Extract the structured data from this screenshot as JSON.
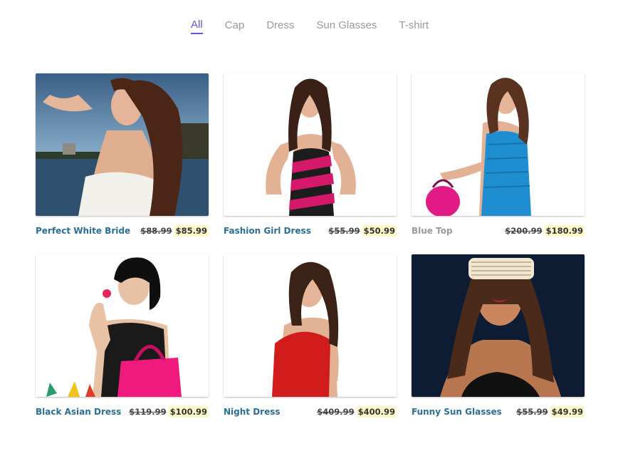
{
  "filters": {
    "tabs": [
      "All",
      "Cap",
      "Dress",
      "Sun Glasses",
      "T-shirt"
    ],
    "active": "All"
  },
  "products": [
    {
      "name": "Perfect White Bride",
      "old_price": "$88.99",
      "price": "$85.99",
      "image": "woman with curly hair, white strapless dress, lake background"
    },
    {
      "name": "Fashion Girl Dress",
      "old_price": "$55.99",
      "price": "$50.99",
      "image": "woman in black and pink striped dress"
    },
    {
      "name": "Blue Top",
      "old_price": "$200.99",
      "price": "$180.99",
      "image": "woman in blue top holding pink bag"
    },
    {
      "name": "Black Asian Dress",
      "old_price": "$119.99",
      "price": "$100.99",
      "image": "woman with pink handbag smelling a flower"
    },
    {
      "name": "Night Dress",
      "old_price": "$409.99",
      "price": "$400.99",
      "image": "woman in red dress pointing"
    },
    {
      "name": "Funny Sun Glasses",
      "old_price": "$55.99",
      "price": "$49.99",
      "image": "woman with shutter shades on dark background"
    }
  ],
  "colors": {
    "accent": "#5b5bd6",
    "product_name": "#2b6f97",
    "price_highlight": "#fcf7c9"
  }
}
